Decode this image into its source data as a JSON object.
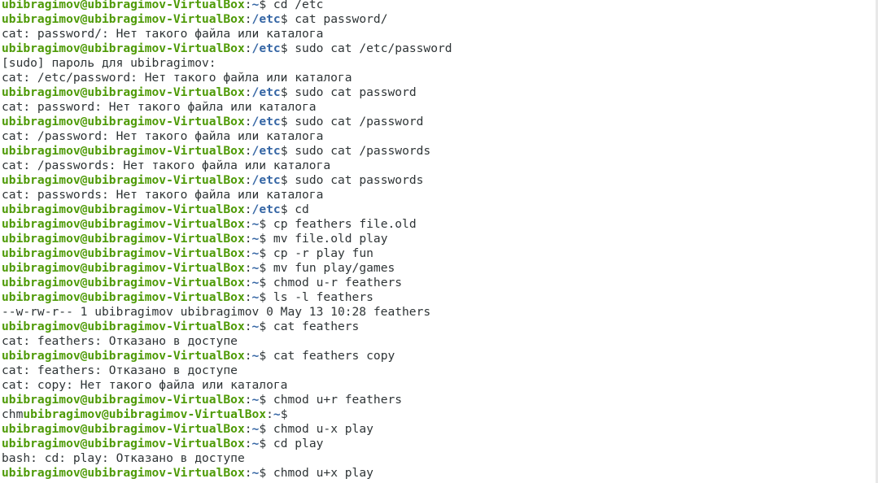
{
  "colors": {
    "background": "#ffffff",
    "text": "#2e3436",
    "prompt_user": "#4e9a06",
    "prompt_path": "#3465a4"
  },
  "terminal": {
    "lines": [
      {
        "type": "prompt",
        "user": "ubibragimov@ubibragimov-VirtualBox",
        "path": "~",
        "command": " cd /etc"
      },
      {
        "type": "prompt",
        "user": "ubibragimov@ubibragimov-VirtualBox",
        "path": "/etc",
        "command": " cat password/"
      },
      {
        "type": "output",
        "text": "cat: password/: Нет такого файла или каталога"
      },
      {
        "type": "prompt",
        "user": "ubibragimov@ubibragimov-VirtualBox",
        "path": "/etc",
        "command": " sudo cat /etc/password"
      },
      {
        "type": "output",
        "text": "[sudo] пароль для ubibragimov:"
      },
      {
        "type": "output",
        "text": "cat: /etc/password: Нет такого файла или каталога"
      },
      {
        "type": "prompt",
        "user": "ubibragimov@ubibragimov-VirtualBox",
        "path": "/etc",
        "command": " sudo cat password"
      },
      {
        "type": "output",
        "text": "cat: password: Нет такого файла или каталога"
      },
      {
        "type": "prompt",
        "user": "ubibragimov@ubibragimov-VirtualBox",
        "path": "/etc",
        "command": " sudo cat /password"
      },
      {
        "type": "output",
        "text": "cat: /password: Нет такого файла или каталога"
      },
      {
        "type": "prompt",
        "user": "ubibragimov@ubibragimov-VirtualBox",
        "path": "/etc",
        "command": " sudo cat /passwords"
      },
      {
        "type": "output",
        "text": "cat: /passwords: Нет такого файла или каталога"
      },
      {
        "type": "prompt",
        "user": "ubibragimov@ubibragimov-VirtualBox",
        "path": "/etc",
        "command": " sudo cat passwords"
      },
      {
        "type": "output",
        "text": "cat: passwords: Нет такого файла или каталога"
      },
      {
        "type": "prompt",
        "user": "ubibragimov@ubibragimov-VirtualBox",
        "path": "/etc",
        "command": " cd"
      },
      {
        "type": "prompt",
        "user": "ubibragimov@ubibragimov-VirtualBox",
        "path": "~",
        "command": " cp feathers file.old"
      },
      {
        "type": "prompt",
        "user": "ubibragimov@ubibragimov-VirtualBox",
        "path": "~",
        "command": " mv file.old play"
      },
      {
        "type": "prompt",
        "user": "ubibragimov@ubibragimov-VirtualBox",
        "path": "~",
        "command": " cp -r play fun"
      },
      {
        "type": "prompt",
        "user": "ubibragimov@ubibragimov-VirtualBox",
        "path": "~",
        "command": " mv fun play/games"
      },
      {
        "type": "prompt",
        "user": "ubibragimov@ubibragimov-VirtualBox",
        "path": "~",
        "command": " chmod u-r feathers"
      },
      {
        "type": "prompt",
        "user": "ubibragimov@ubibragimov-VirtualBox",
        "path": "~",
        "command": " ls -l feathers"
      },
      {
        "type": "output",
        "text": "--w-rw-r-- 1 ubibragimov ubibragimov 0 May 13 10:28 feathers"
      },
      {
        "type": "prompt",
        "user": "ubibragimov@ubibragimov-VirtualBox",
        "path": "~",
        "command": " cat feathers"
      },
      {
        "type": "output",
        "text": "cat: feathers: Отказано в доступе"
      },
      {
        "type": "prompt",
        "user": "ubibragimov@ubibragimov-VirtualBox",
        "path": "~",
        "command": " cat feathers copy"
      },
      {
        "type": "output",
        "text": "cat: feathers: Отказано в доступе"
      },
      {
        "type": "output",
        "text": "cat: copy: Нет такого файла или каталога"
      },
      {
        "type": "prompt",
        "user": "ubibragimov@ubibragimov-VirtualBox",
        "path": "~",
        "command": " chmod u+r feathers"
      },
      {
        "type": "prompt",
        "prefix": "chm",
        "user": "ubibragimov@ubibragimov-VirtualBox",
        "path": "~",
        "command": ""
      },
      {
        "type": "prompt",
        "user": "ubibragimov@ubibragimov-VirtualBox",
        "path": "~",
        "command": " chmod u-x play"
      },
      {
        "type": "prompt",
        "user": "ubibragimov@ubibragimov-VirtualBox",
        "path": "~",
        "command": " cd play"
      },
      {
        "type": "output",
        "text": "bash: cd: play: Отказано в доступе"
      },
      {
        "type": "prompt",
        "user": "ubibragimov@ubibragimov-VirtualBox",
        "path": "~",
        "command": " chmod u+x play"
      }
    ]
  }
}
